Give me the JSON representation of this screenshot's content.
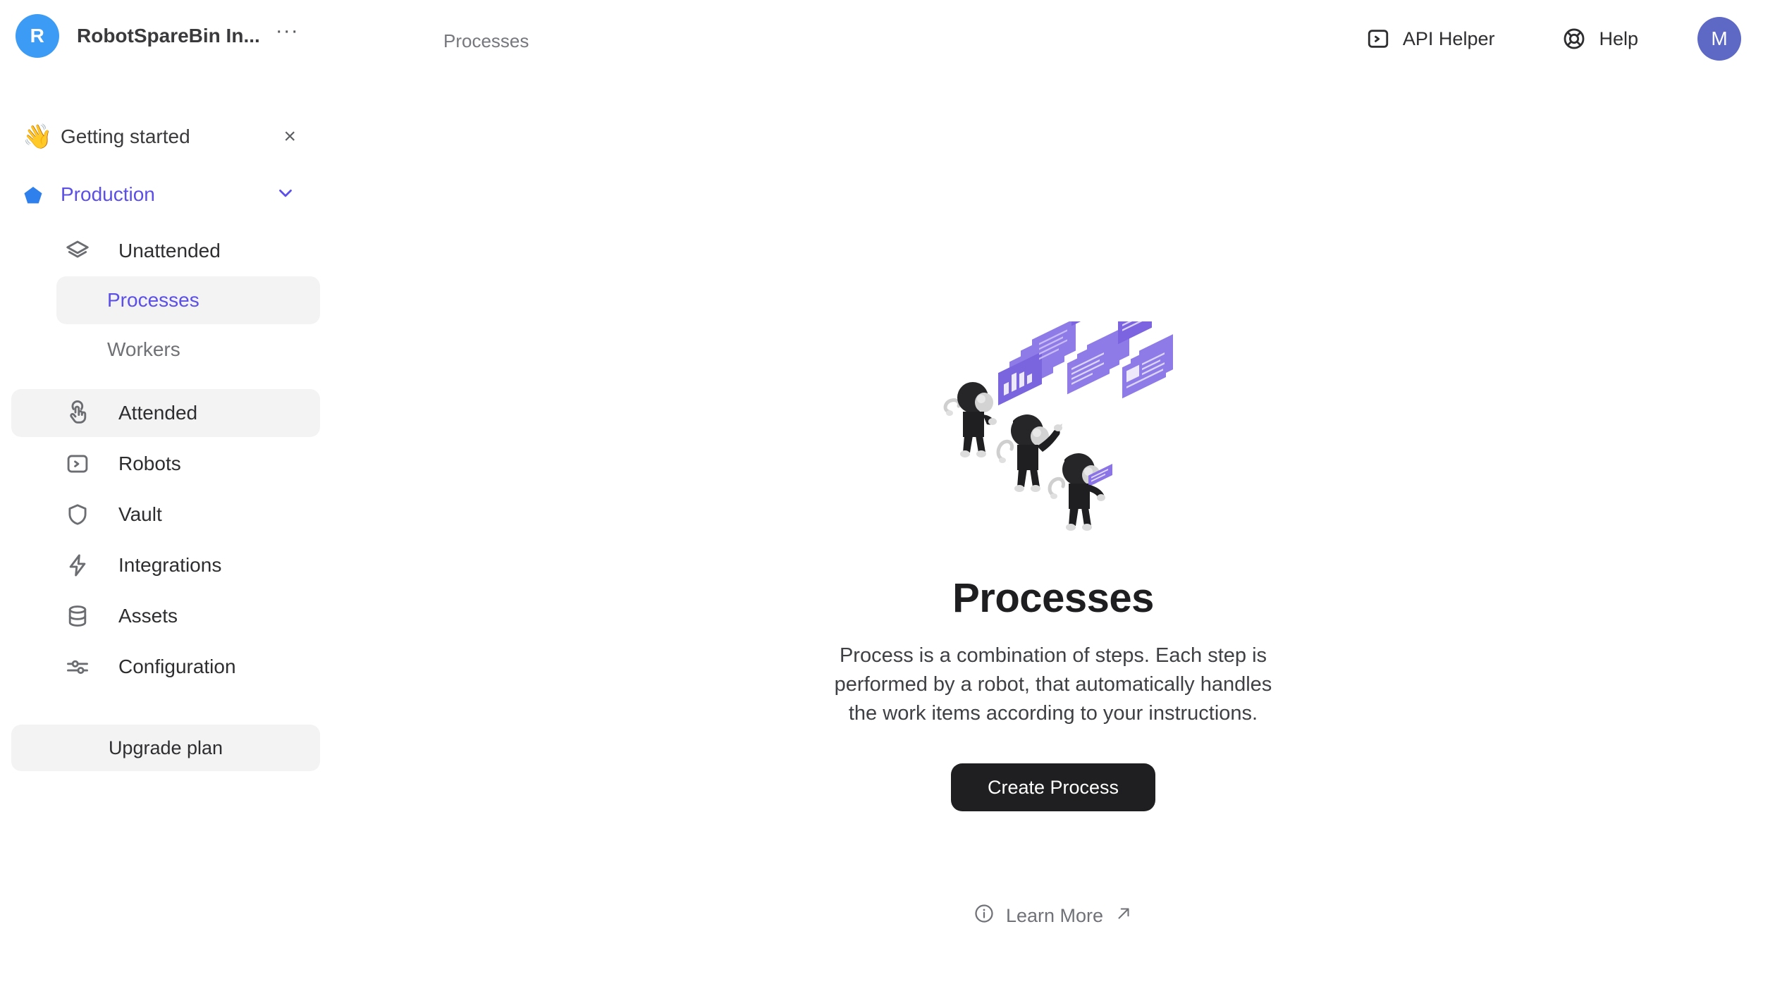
{
  "header": {
    "org_initial": "R",
    "org_name": "RobotSpareBin In...",
    "org_more": "···",
    "breadcrumb": "Processes",
    "api_helper_label": "API Helper",
    "api_helper_icon": "terminal-icon",
    "help_label": "Help",
    "help_icon": "lifebuoy-icon",
    "user_initial": "M",
    "colors": {
      "org_avatar": "#3B9BF5",
      "user_avatar": "#5D69C4"
    }
  },
  "sidebar": {
    "getting_started": {
      "emoji": "👋",
      "label": "Getting started",
      "close_icon": "close-icon",
      "close_glyph": "×"
    },
    "workspace": {
      "label": "Production",
      "icon": "pentagon-icon",
      "icon_color": "#2F80ED",
      "text_color": "#5B4FE8",
      "chevron_icon": "chevron-down-icon"
    },
    "group": {
      "label": "Unattended",
      "icon": "layers-icon"
    },
    "sub_items": [
      {
        "label": "Processes",
        "active": true
      },
      {
        "label": "Workers",
        "active": false
      }
    ],
    "items": [
      {
        "label": "Attended",
        "icon": "hand-tap-icon",
        "active": true
      },
      {
        "label": "Robots",
        "icon": "terminal-icon",
        "active": false
      },
      {
        "label": "Vault",
        "icon": "shield-icon",
        "active": false
      },
      {
        "label": "Integrations",
        "icon": "lightning-icon",
        "active": false
      },
      {
        "label": "Assets",
        "icon": "database-icon",
        "active": false
      },
      {
        "label": "Configuration",
        "icon": "sliders-icon",
        "active": false
      }
    ],
    "upgrade_label": "Upgrade plan"
  },
  "main": {
    "illustration_name": "robots-viewing-panels-illustration",
    "title": "Processes",
    "description": "Process is a combination of steps. Each step is performed by a robot, that automatically handles the work items according to your instructions.",
    "create_button": "Create Process",
    "learn_more": "Learn More",
    "learn_more_info_icon": "info-circle-icon",
    "learn_more_external_icon": "arrow-up-right-icon",
    "colors": {
      "accent_purple": "#6C54D8",
      "button_dark": "#1F1F21"
    }
  }
}
